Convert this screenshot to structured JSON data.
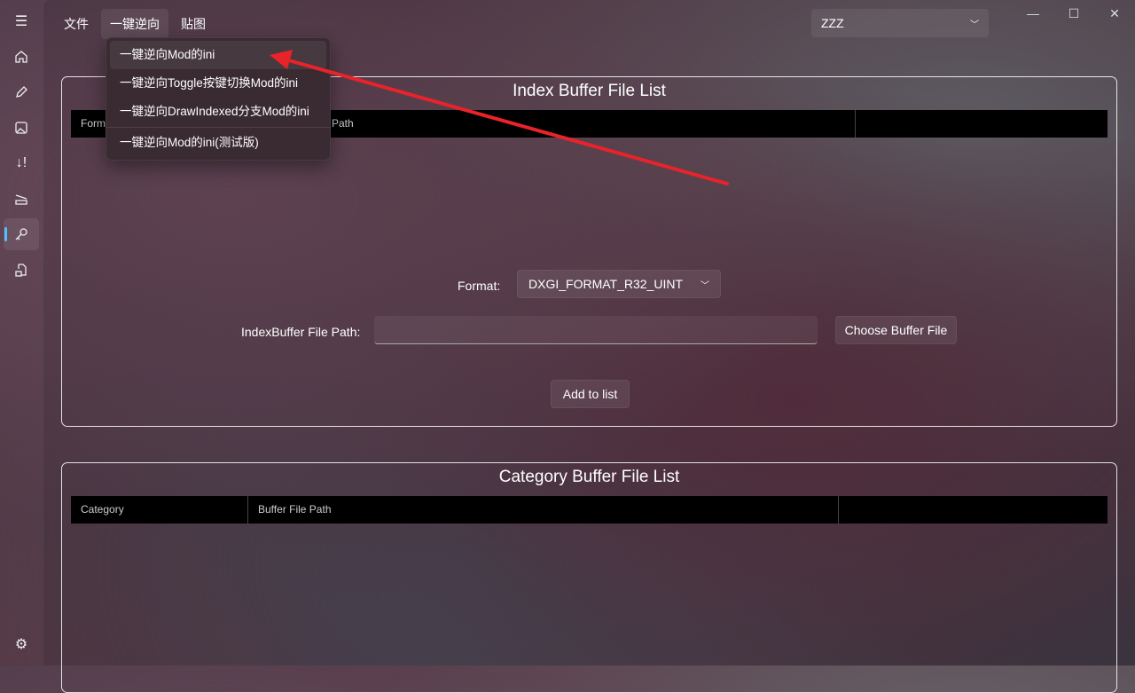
{
  "menubar": {
    "items": [
      "文件",
      "一键逆向",
      "贴图"
    ]
  },
  "flyout": {
    "items": [
      "一键逆向Mod的ini",
      "一键逆向Toggle按键切换Mod的ini",
      "一键逆向DrawIndexed分支Mod的ini",
      "一键逆向Mod的ini(测试版)"
    ]
  },
  "game_selector": {
    "value": "ZZZ"
  },
  "index_panel": {
    "title": "Index Buffer File List",
    "columns": [
      "Format",
      "Path",
      ""
    ],
    "format_label": "Format:",
    "format_value": "DXGI_FORMAT_R32_UINT",
    "path_label": "IndexBuffer File Path:",
    "path_value": "",
    "choose_button": "Choose Buffer File",
    "add_button": "Add to list"
  },
  "category_panel": {
    "title": "Category Buffer File List",
    "columns": [
      "Category",
      "Buffer File Path",
      ""
    ]
  },
  "annotation": {
    "arrow_color": "#e8232a"
  }
}
